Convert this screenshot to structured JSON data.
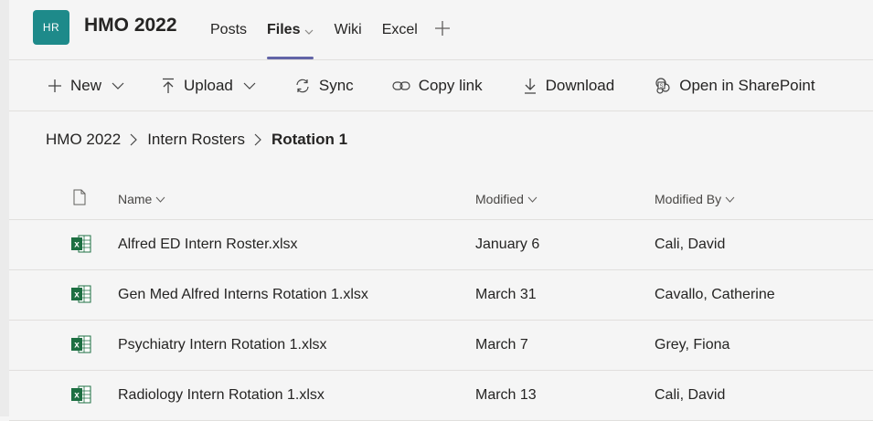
{
  "header": {
    "avatar_initials": "HR",
    "team_name": "HMO 2022",
    "tabs": [
      {
        "label": "Posts",
        "active": false
      },
      {
        "label": "Files",
        "active": true
      },
      {
        "label": "Wiki",
        "active": false
      },
      {
        "label": "Excel",
        "active": false
      }
    ],
    "add_tab_symbol": "+"
  },
  "toolbar": {
    "new_label": "New",
    "upload_label": "Upload",
    "sync_label": "Sync",
    "copy_link_label": "Copy link",
    "download_label": "Download",
    "open_sharepoint_label": "Open in SharePoint"
  },
  "breadcrumb": [
    "HMO 2022",
    "Intern Rosters",
    "Rotation 1"
  ],
  "table": {
    "columns": {
      "name": "Name",
      "modified": "Modified",
      "modified_by": "Modified By"
    },
    "rows": [
      {
        "name": "Alfred ED Intern Roster.xlsx",
        "modified": "January 6",
        "modified_by": "Cali, David"
      },
      {
        "name": "Gen Med Alfred Interns Rotation 1.xlsx",
        "modified": "March 31",
        "modified_by": "Cavallo, Catherine"
      },
      {
        "name": "Psychiatry Intern Rotation 1.xlsx",
        "modified": "March 7",
        "modified_by": "Grey, Fiona"
      },
      {
        "name": "Radiology Intern Rotation 1.xlsx",
        "modified": "March 13",
        "modified_by": "Cali, David"
      }
    ]
  },
  "colors": {
    "accent": "#6264a7",
    "avatar": "#1e8a8a",
    "excel_green": "#1d6f42"
  },
  "icons": [
    "plus-icon",
    "chevron-down-icon",
    "upload-icon",
    "sync-icon",
    "link-icon",
    "download-icon",
    "sharepoint-icon",
    "chevron-right-icon",
    "file-icon",
    "excel-file-icon"
  ]
}
